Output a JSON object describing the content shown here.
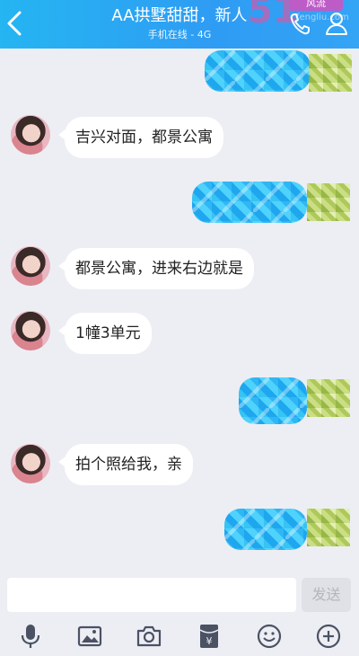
{
  "header": {
    "title": "AA拱墅甜甜，新人",
    "subtitle": "手机在线 - 4G",
    "watermark_number": "51",
    "watermark_badge": "风流",
    "watermark_url": "fengliu.com"
  },
  "messages": [
    {
      "side": "right",
      "type": "pixelated"
    },
    {
      "side": "left",
      "text": "吉兴对面，都景公寓"
    },
    {
      "side": "right",
      "type": "pixelated"
    },
    {
      "side": "left",
      "text": "都景公寓，进来右边就是"
    },
    {
      "side": "left",
      "text": "1幢3单元"
    },
    {
      "side": "right",
      "type": "pixelated"
    },
    {
      "side": "left",
      "text": "拍个照给我，亲"
    },
    {
      "side": "right",
      "type": "pixelated"
    }
  ],
  "input": {
    "value": "",
    "placeholder": "",
    "send_label": "发送"
  },
  "toolbar": {
    "icons": [
      "microphone-icon",
      "image-icon",
      "camera-icon",
      "red-packet-icon",
      "emoji-icon",
      "plus-icon"
    ]
  },
  "colors": {
    "header_gradient_start": "#25b5f2",
    "header_gradient_end": "#34a4f5",
    "background": "#edeef3",
    "bubble_left": "#ffffff",
    "icon": "#4a5264"
  }
}
